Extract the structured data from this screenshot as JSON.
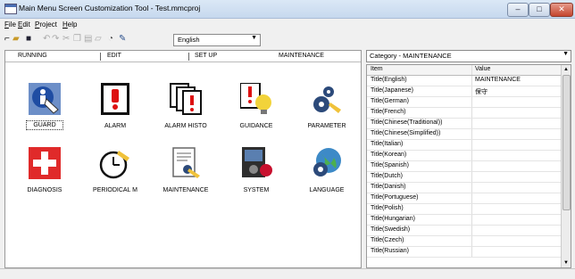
{
  "window": {
    "title": "Main Menu Screen Customization Tool - Test.mmcproj"
  },
  "menu": [
    "File",
    "Edit",
    "Project",
    "Help"
  ],
  "toolbar": {
    "language_value": "English"
  },
  "tabs": [
    "RUNNING",
    "EDIT",
    "SET UP",
    "MAINTENANCE"
  ],
  "items": [
    {
      "label": "GUARD",
      "icon": "guard-icon"
    },
    {
      "label": "ALARM",
      "icon": "alarm-icon"
    },
    {
      "label": "ALARM HISTO",
      "icon": "alarm-history-icon"
    },
    {
      "label": "GUIDANCE",
      "icon": "guidance-icon"
    },
    {
      "label": "PARAMETER",
      "icon": "parameter-icon"
    },
    {
      "label": "DIAGNOSIS",
      "icon": "diagnosis-icon"
    },
    {
      "label": "PERIODICAL M",
      "icon": "periodical-maintenance-icon"
    },
    {
      "label": "MAINTENANCE",
      "icon": "maintenance-icon"
    },
    {
      "label": "SYSTEM",
      "icon": "system-icon"
    },
    {
      "label": "LANGUAGE",
      "icon": "language-icon"
    }
  ],
  "properties": {
    "category": "Category - MAINTENANCE",
    "headers": {
      "item": "Item",
      "value": "Value"
    },
    "rows": [
      {
        "item": "Title(English)",
        "value": "MAINTENANCE"
      },
      {
        "item": "Title(Japanese)",
        "value": "保守"
      },
      {
        "item": "Title(German)",
        "value": ""
      },
      {
        "item": "Title(French)",
        "value": ""
      },
      {
        "item": "Title(Chinese(Traditional))",
        "value": ""
      },
      {
        "item": "Title(Chinese(Simplified))",
        "value": ""
      },
      {
        "item": "Title(Italian)",
        "value": ""
      },
      {
        "item": "Title(Korean)",
        "value": ""
      },
      {
        "item": "Title(Spanish)",
        "value": ""
      },
      {
        "item": "Title(Dutch)",
        "value": ""
      },
      {
        "item": "Title(Danish)",
        "value": ""
      },
      {
        "item": "Title(Portuguese)",
        "value": ""
      },
      {
        "item": "Title(Polish)",
        "value": ""
      },
      {
        "item": "Title(Hungarian)",
        "value": ""
      },
      {
        "item": "Title(Swedish)",
        "value": ""
      },
      {
        "item": "Title(Czech)",
        "value": ""
      },
      {
        "item": "Title(Russian)",
        "value": ""
      }
    ]
  }
}
